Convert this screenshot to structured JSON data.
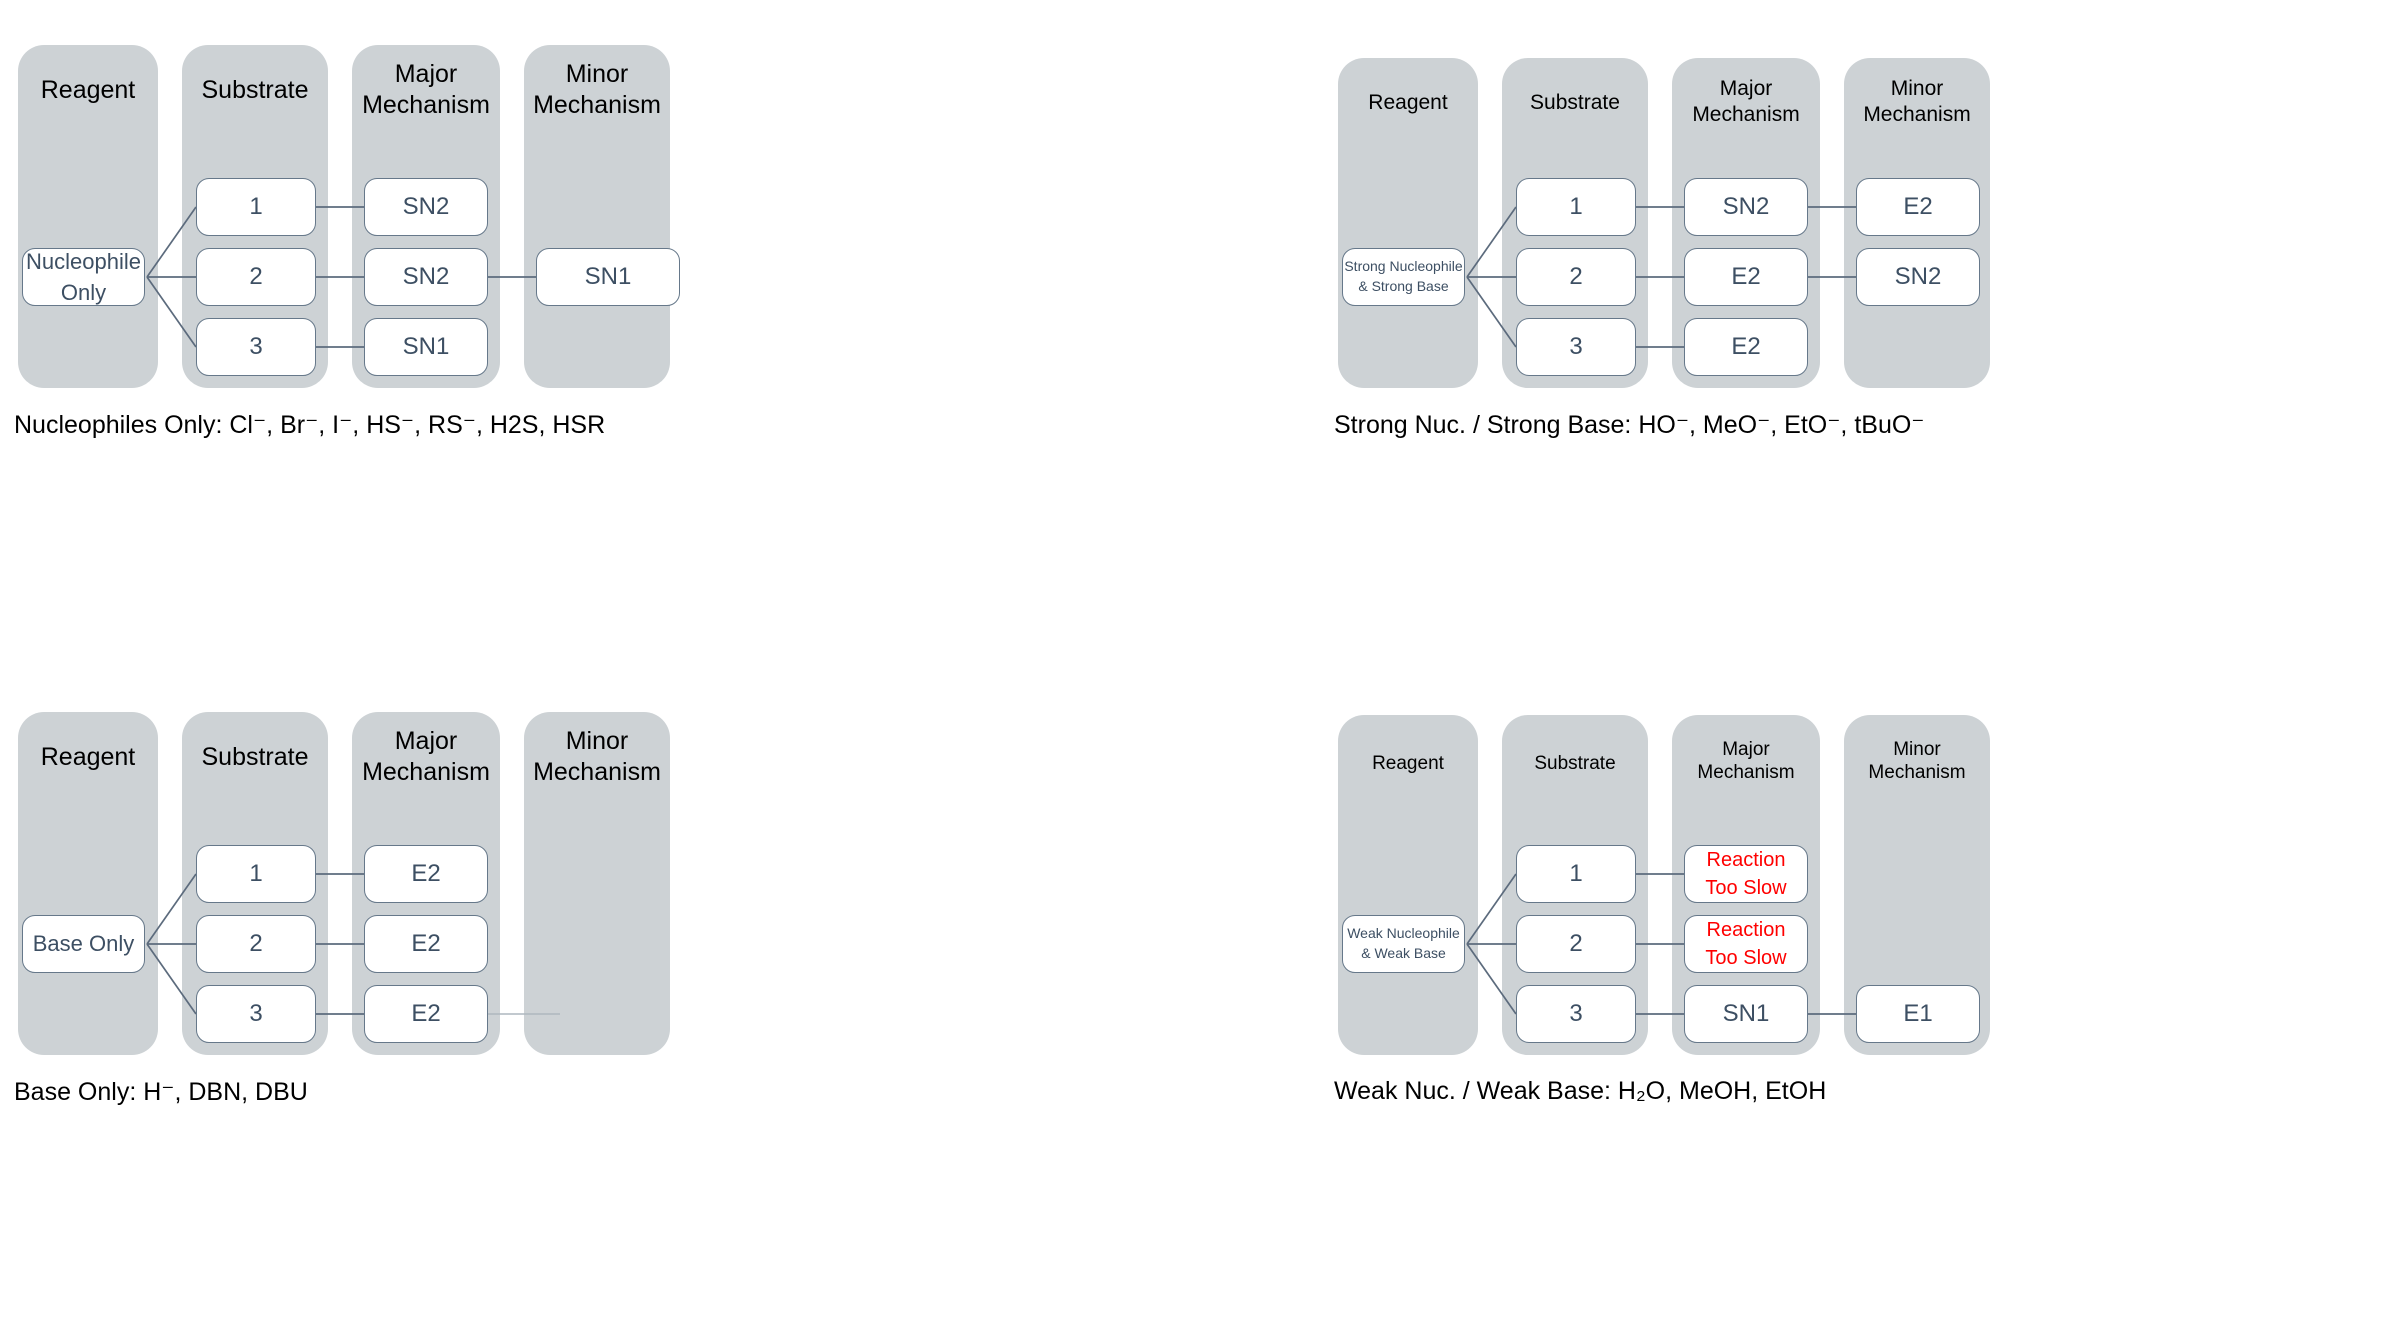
{
  "quadrants": [
    {
      "id": "nucleophiles-only",
      "columns": [
        "Reagent",
        "Substrate",
        "Major\nMechanism",
        "Minor\nMechanism"
      ],
      "reagent": "Nucleophile\nOnly",
      "substrates": [
        "1",
        "2",
        "3"
      ],
      "major": [
        "SN2",
        "SN2",
        "SN1"
      ],
      "minor": [
        "",
        "SN1",
        ""
      ],
      "caption_label": "Nucleophiles Only:",
      "caption_reagents": "Cl⁻, Br⁻, I⁻, HS⁻, RS⁻, H2S, HSR",
      "caption_full": "Nucleophiles Only:  Cl⁻, Br⁻, I⁻, HS⁻, RS⁻, H2S, HSR"
    },
    {
      "id": "strong-nuc-strong-base",
      "columns": [
        "Reagent",
        "Substrate",
        "Major\nMechanism",
        "Minor\nMechanism"
      ],
      "reagent": "Strong Nucleophile\n& Strong Base",
      "substrates": [
        "1",
        "2",
        "3"
      ],
      "major": [
        "SN2",
        "E2",
        "E2"
      ],
      "minor": [
        "E2",
        "SN2",
        ""
      ],
      "caption_label": "Strong Nuc. / Strong Base:",
      "caption_reagents": "HO⁻, MeO⁻, EtO⁻, tBuO⁻",
      "caption_full": "Strong Nuc. / Strong Base:  HO⁻, MeO⁻, EtO⁻, tBuO⁻"
    },
    {
      "id": "base-only",
      "columns": [
        "Reagent",
        "Substrate",
        "Major\nMechanism",
        "Minor\nMechanism"
      ],
      "reagent": "Base Only",
      "substrates": [
        "1",
        "2",
        "3"
      ],
      "major": [
        "E2",
        "E2",
        "E2"
      ],
      "minor": [
        "",
        "",
        ""
      ],
      "caption_label": "Base Only:",
      "caption_reagents": "H⁻, DBN, DBU",
      "caption_full": "Base Only:  H⁻, DBN, DBU"
    },
    {
      "id": "weak-nuc-weak-base",
      "columns": [
        "Reagent",
        "Substrate",
        "Major\nMechanism",
        "Minor\nMechanism"
      ],
      "reagent": "Weak Nucleophile\n& Weak Base",
      "substrates": [
        "1",
        "2",
        "3"
      ],
      "major": [
        "Reaction\nToo Slow",
        "Reaction\nToo Slow",
        "SN1"
      ],
      "minor": [
        "",
        "",
        "E1"
      ],
      "caption_label": "Weak Nuc. / Weak Base:",
      "caption_reagents": "H2O, MeOH, EtOH",
      "caption_full": "Weak Nuc. / Weak Base:  H₂O, MeOH, EtOH"
    }
  ],
  "colors": {
    "column_fill": "#cdd2d5",
    "node_fill": "#ffffff",
    "node_border": "#66788a",
    "node_text": "#3d4f63",
    "warning_text": "#ff0000",
    "header_text": "#000000",
    "connector": "#5c6b7d",
    "background": "#ffffff"
  }
}
